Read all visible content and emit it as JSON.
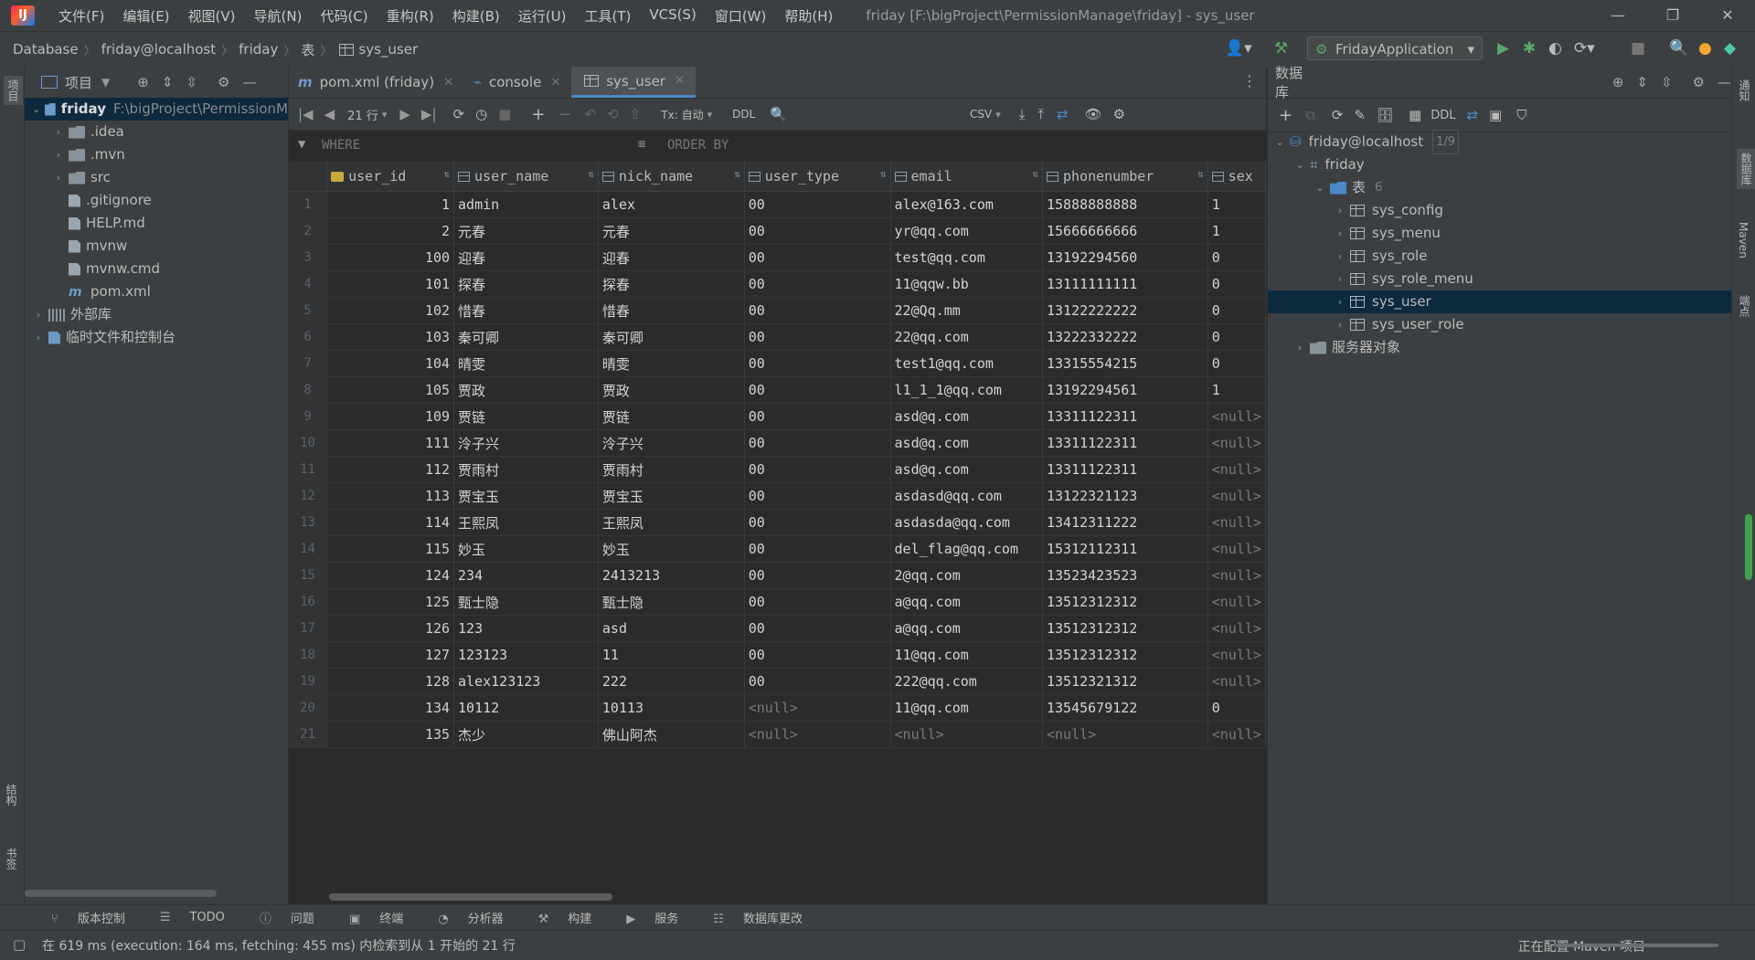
{
  "menubar": {
    "items": [
      "文件(F)",
      "编辑(E)",
      "视图(V)",
      "导航(N)",
      "代码(C)",
      "重构(R)",
      "构建(B)",
      "运行(U)",
      "工具(T)",
      "VCS(S)",
      "窗口(W)",
      "帮助(H)"
    ],
    "window_title": "friday [F:\\bigProject\\PermissionManage\\friday] - sys_user"
  },
  "breadcrumb": [
    "Database",
    "friday@localhost",
    "friday",
    "表",
    "sys_user"
  ],
  "run_config": "FridayApplication",
  "project_panel": {
    "title": "项目",
    "tree": [
      {
        "label": "friday",
        "extra": "F:\\bigProject\\PermissionM",
        "level": 0,
        "arrow": "v",
        "icon": "module",
        "selected": true
      },
      {
        "label": ".idea",
        "level": 1,
        "arrow": ">",
        "icon": "folder"
      },
      {
        "label": ".mvn",
        "level": 1,
        "arrow": ">",
        "icon": "folder"
      },
      {
        "label": "src",
        "level": 1,
        "arrow": ">",
        "icon": "folder"
      },
      {
        "label": ".gitignore",
        "level": 1,
        "arrow": "",
        "icon": "file"
      },
      {
        "label": "HELP.md",
        "level": 1,
        "arrow": "",
        "icon": "file"
      },
      {
        "label": "mvnw",
        "level": 1,
        "arrow": "",
        "icon": "file"
      },
      {
        "label": "mvnw.cmd",
        "level": 1,
        "arrow": "",
        "icon": "file"
      },
      {
        "label": "pom.xml",
        "level": 1,
        "arrow": "",
        "icon": "maven"
      },
      {
        "label": "外部库",
        "level": 0,
        "arrow": ">",
        "icon": "lib"
      },
      {
        "label": "临时文件和控制台",
        "level": 0,
        "arrow": ">",
        "icon": "scratch"
      }
    ]
  },
  "left_strip": {
    "top_label": "项目",
    "bottom_label_1": "结构",
    "bottom_label_2": "书签"
  },
  "right_strip": {
    "labels": [
      "通知",
      "数据库",
      "Maven",
      "端点"
    ]
  },
  "editor_tabs": [
    {
      "label": "pom.xml (friday)",
      "active": false
    },
    {
      "label": "console",
      "active": false
    },
    {
      "label": "sys_user",
      "active": true
    }
  ],
  "grid_toolbar": {
    "rows_label": "21 行",
    "tx_label": "Tx: 自动",
    "ddl_label": "DDL",
    "export_label": "CSV"
  },
  "filter": {
    "where": "WHERE",
    "order_by": "ORDER BY"
  },
  "table": {
    "columns": [
      "user_id",
      "user_name",
      "nick_name",
      "user_type",
      "email",
      "phonenumber",
      "sex"
    ],
    "rows": [
      [
        "1",
        "1",
        "admin",
        "alex",
        "00",
        "alex@163.com",
        "15888888888",
        "1"
      ],
      [
        "2",
        "2",
        "元春",
        "元春",
        "00",
        "yr@qq.com",
        "15666666666",
        "1"
      ],
      [
        "3",
        "100",
        "迎春",
        "迎春",
        "00",
        "test@qq.com",
        "13192294560",
        "0"
      ],
      [
        "4",
        "101",
        "探春",
        "探春",
        "00",
        "11@qqw.bb",
        "13111111111",
        "0"
      ],
      [
        "5",
        "102",
        "惜春",
        "惜春",
        "00",
        "22@Qq.mm",
        "13122222222",
        "0"
      ],
      [
        "6",
        "103",
        "秦可卿",
        "秦可卿",
        "00",
        "22@qq.com",
        "13222332222",
        "0"
      ],
      [
        "7",
        "104",
        "晴雯",
        "晴雯",
        "00",
        "test1@qq.com",
        "13315554215",
        "0"
      ],
      [
        "8",
        "105",
        "贾政",
        "贾政",
        "00",
        "l1_1_1@qq.com",
        "13192294561",
        "1"
      ],
      [
        "9",
        "109",
        "贾链",
        "贾链",
        "00",
        "asd@q.com",
        "13311122311",
        "<null>"
      ],
      [
        "10",
        "111",
        "泠子兴",
        "泠子兴",
        "00",
        "asd@q.com",
        "13311122311",
        "<null>"
      ],
      [
        "11",
        "112",
        "贾雨村",
        "贾雨村",
        "00",
        "asd@q.com",
        "13311122311",
        "<null>"
      ],
      [
        "12",
        "113",
        "贾宝玉",
        "贾宝玉",
        "00",
        "asdasd@qq.com",
        "13122321123",
        "<null>"
      ],
      [
        "13",
        "114",
        "王熙凤",
        "王熙凤",
        "00",
        "asdasda@qq.com",
        "13412311222",
        "<null>"
      ],
      [
        "14",
        "115",
        "妙玉",
        "妙玉",
        "00",
        "del_flag@qq.com",
        "15312112311",
        "<null>"
      ],
      [
        "15",
        "124",
        "234",
        "2413213",
        "00",
        "2@qq.com",
        "13523423523",
        "<null>"
      ],
      [
        "16",
        "125",
        "甄士隐",
        "甄士隐",
        "00",
        "a@qq.com",
        "13512312312",
        "<null>"
      ],
      [
        "17",
        "126",
        "123",
        "asd",
        "00",
        "a@qq.com",
        "13512312312",
        "<null>"
      ],
      [
        "18",
        "127",
        "123123",
        "11",
        "00",
        "11@qq.com",
        "13512312312",
        "<null>"
      ],
      [
        "19",
        "128",
        "alex123123",
        "222",
        "00",
        "222@qq.com",
        "13512321312",
        "<null>"
      ],
      [
        "20",
        "134",
        "10112",
        "10113",
        "<null>",
        "11@qq.com",
        "13545679122",
        "0"
      ],
      [
        "21",
        "135",
        "杰少",
        "佛山阿杰",
        "<null>",
        "<null>",
        "<null>",
        "<null>"
      ]
    ]
  },
  "db_panel": {
    "title": "数据库",
    "ddl_label": "DDL",
    "tree": [
      {
        "label": "friday@localhost",
        "badge": "1/9",
        "level": 0,
        "arrow": "v",
        "icon": "datasource"
      },
      {
        "label": "friday",
        "level": 1,
        "arrow": "v",
        "icon": "schema"
      },
      {
        "label": "表",
        "badge": "6",
        "level": 2,
        "arrow": "v",
        "icon": "folder"
      },
      {
        "label": "sys_config",
        "level": 3,
        "arrow": ">",
        "icon": "table"
      },
      {
        "label": "sys_menu",
        "level": 3,
        "arrow": ">",
        "icon": "table"
      },
      {
        "label": "sys_role",
        "level": 3,
        "arrow": ">",
        "icon": "table"
      },
      {
        "label": "sys_role_menu",
        "level": 3,
        "arrow": ">",
        "icon": "table"
      },
      {
        "label": "sys_user",
        "level": 3,
        "arrow": ">",
        "icon": "table",
        "selected": true
      },
      {
        "label": "sys_user_role",
        "level": 3,
        "arrow": ">",
        "icon": "table"
      },
      {
        "label": "服务器对象",
        "level": 1,
        "arrow": ">",
        "icon": "folder"
      }
    ]
  },
  "bottom_tools": [
    "版本控制",
    "TODO",
    "问题",
    "终端",
    "分析器",
    "构建",
    "服务",
    "数据库更改"
  ],
  "status": {
    "message": "在 619 ms (execution: 164 ms, fetching: 455 ms) 内检索到从 1 开始的 21 行",
    "right": "正在配置 Maven 项目"
  },
  "colors": {
    "accent": "#4a88c7",
    "selection": "#0d293e",
    "run_green": "#59a869"
  }
}
